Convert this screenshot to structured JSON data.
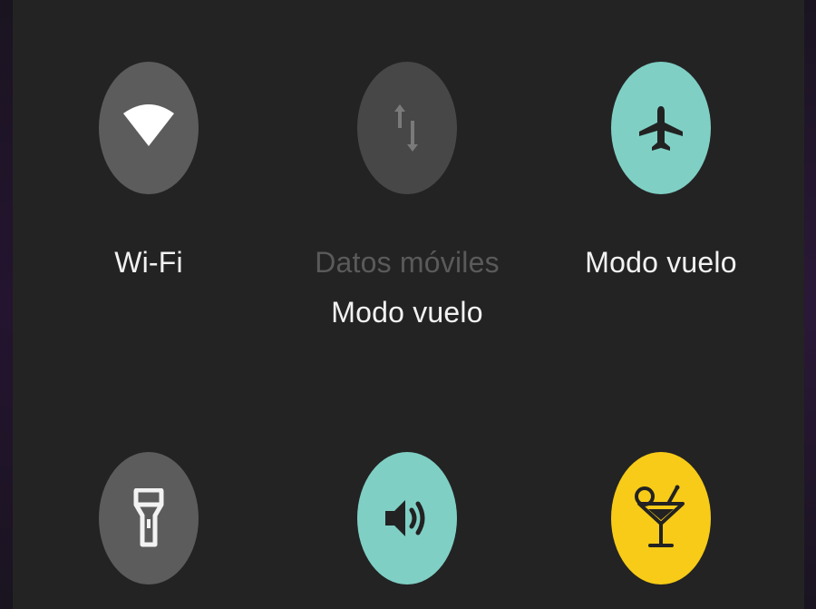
{
  "colors": {
    "background": "#232323",
    "tile_off": "#5c5c5c",
    "tile_disabled": "#474747",
    "tile_on": "#7fcfc4",
    "tile_yellow": "#f7cb17"
  },
  "tiles": [
    {
      "label": "Wi-Fi",
      "icon": "wifi-icon",
      "state": "off"
    },
    {
      "label": "Datos móviles",
      "sublabel": "Modo vuelo",
      "icon": "mobile-data-icon",
      "state": "disabled"
    },
    {
      "label": "Modo vuelo",
      "icon": "airplane-icon",
      "state": "on"
    },
    {
      "label": "",
      "icon": "flashlight-icon",
      "state": "off"
    },
    {
      "label": "",
      "icon": "volume-icon",
      "state": "on"
    },
    {
      "label": "",
      "icon": "cocktail-icon",
      "state": "on"
    }
  ]
}
